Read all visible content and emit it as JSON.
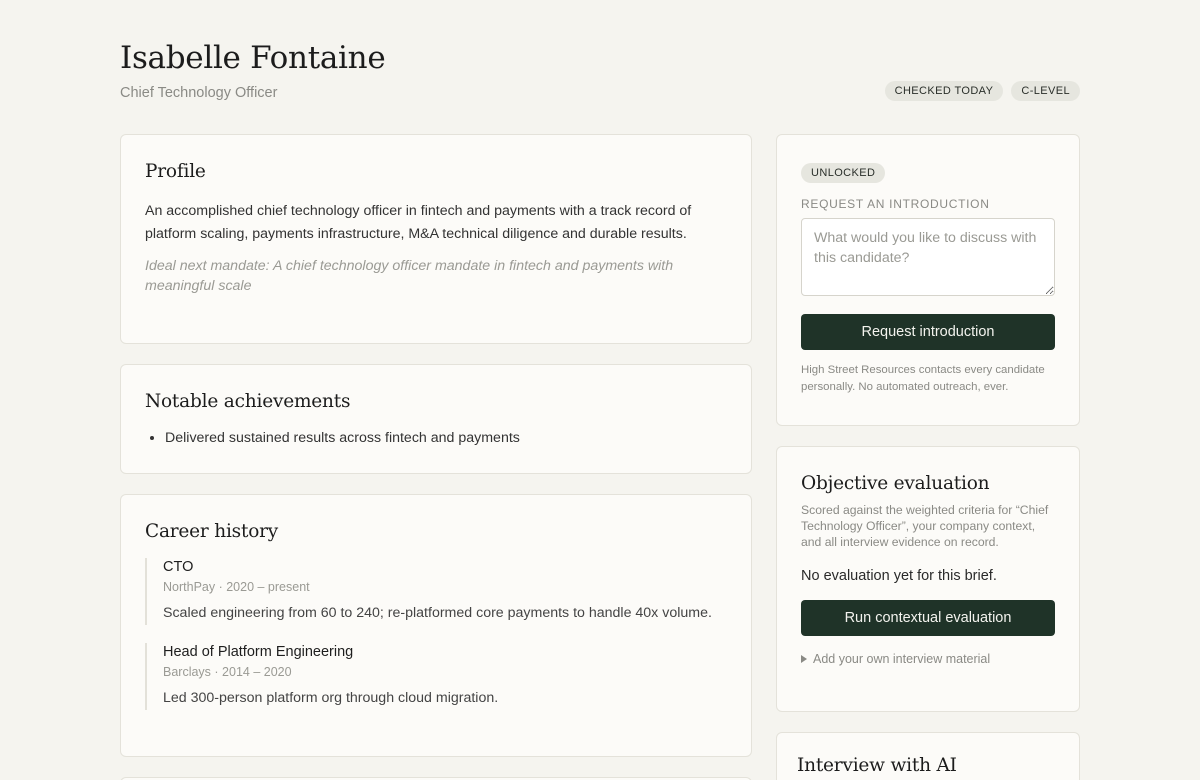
{
  "candidate": {
    "name": "Isabelle Fontaine",
    "role": "Chief Technology Officer",
    "badges": [
      "CHECKED TODAY",
      "C-LEVEL"
    ]
  },
  "profile": {
    "heading": "Profile",
    "summary": "An accomplished chief technology officer in fintech and payments with a track record of platform scaling, payments infrastructure, M&A technical diligence and durable results.",
    "ideal": "Ideal next mandate: A chief technology officer mandate in fintech and payments with meaningful scale"
  },
  "achievements": {
    "heading": "Notable achievements",
    "items": [
      "Delivered sustained results across fintech and payments"
    ]
  },
  "career": {
    "heading": "Career history",
    "jobs": [
      {
        "title": "CTO",
        "meta": "NorthPay · 2020 – present",
        "desc": "Scaled engineering from 60 to 240; re-platformed core payments to handle 40x volume."
      },
      {
        "title": "Head of Platform Engineering",
        "meta": "Barclays · 2014 – 2020",
        "desc": "Led 300-person platform org through cloud migration."
      }
    ]
  },
  "intro": {
    "status": "UNLOCKED",
    "label": "REQUEST AN INTRODUCTION",
    "placeholder": "What would you like to discuss with this candidate?",
    "button": "Request introduction",
    "note": "High Street Resources contacts every candidate personally. No automated outreach, ever."
  },
  "evaluation": {
    "heading": "Objective evaluation",
    "sub": "Scored against the weighted criteria for “Chief Technology Officer”, your company context, and all interview evidence on record.",
    "none": "No evaluation yet for this brief.",
    "button": "Run contextual evaluation",
    "disclosure": "Add your own interview material"
  },
  "interview": {
    "heading": "Interview with AI"
  }
}
